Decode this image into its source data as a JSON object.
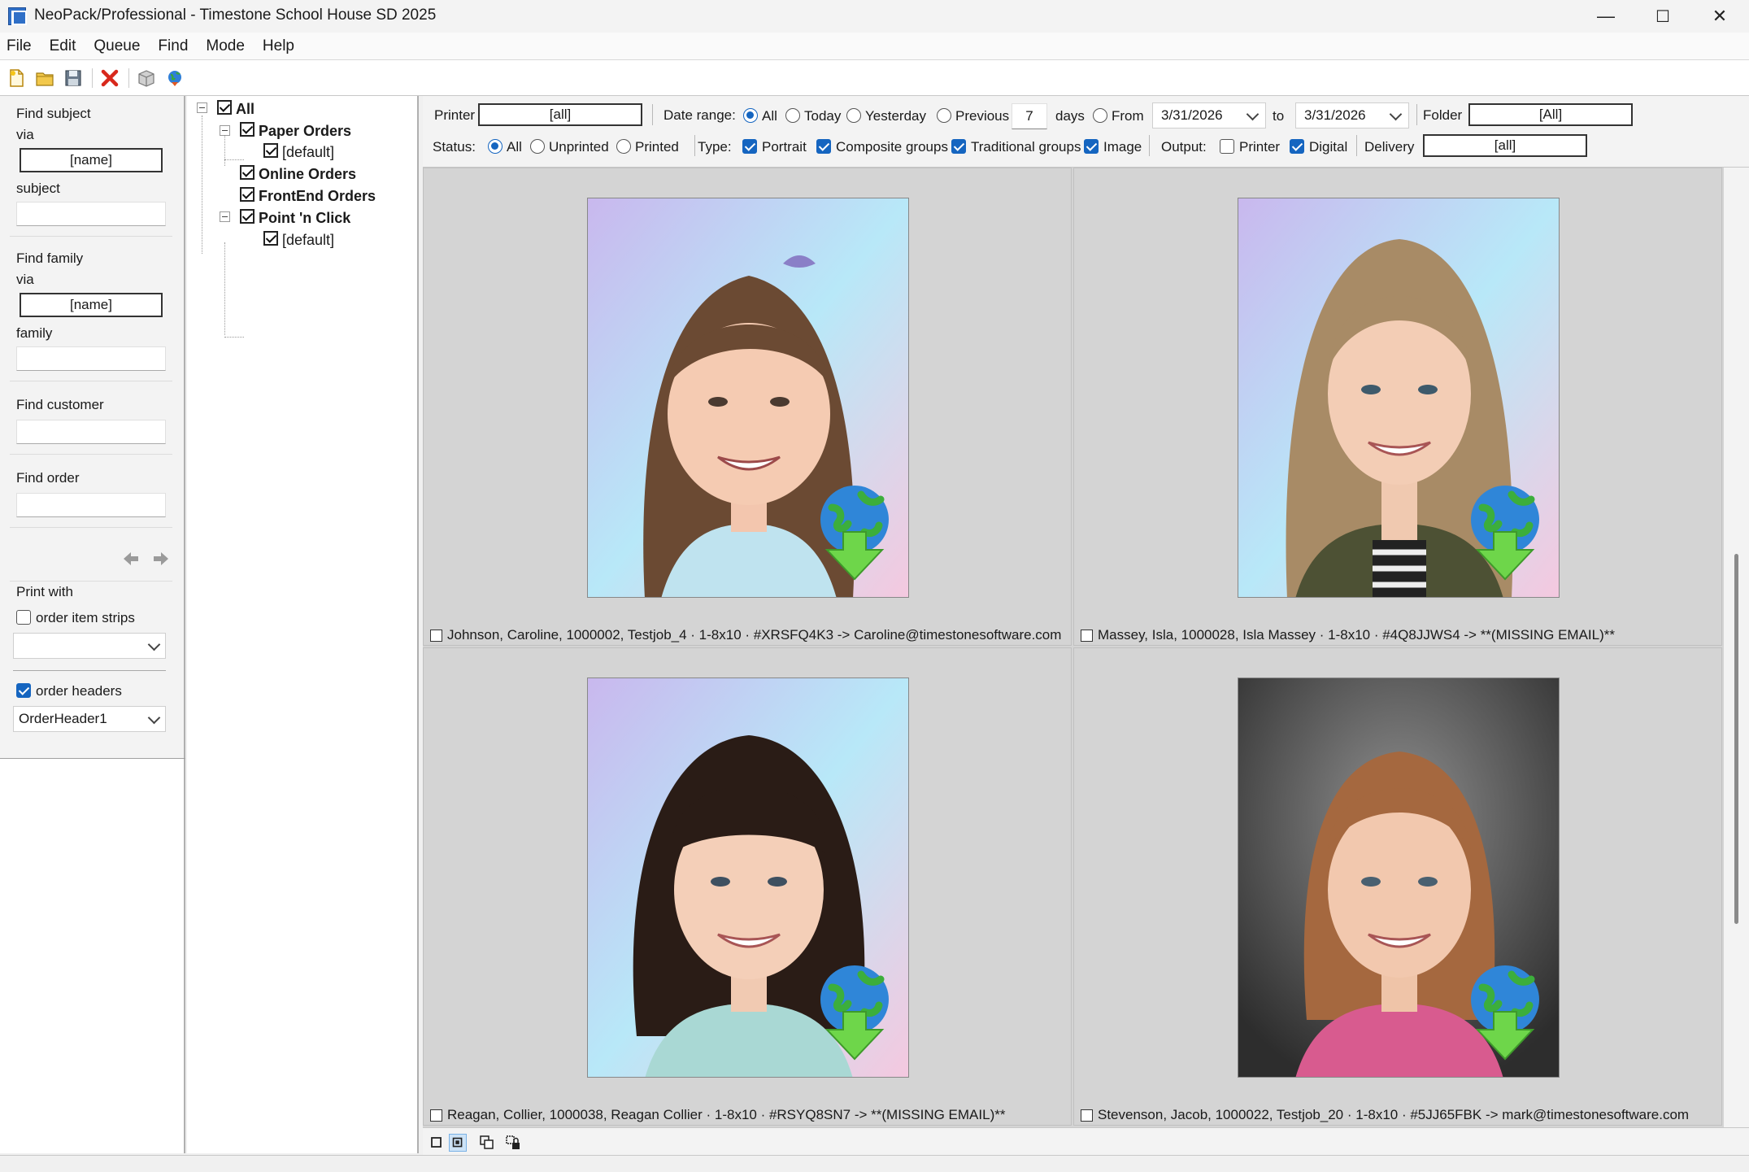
{
  "window": {
    "title": "NeoPack/Professional - Timestone School House SD 2025",
    "minimize": "—",
    "maximize": "☐",
    "close": "✕"
  },
  "menu": [
    "File",
    "Edit",
    "Queue",
    "Find",
    "Mode",
    "Help"
  ],
  "toolbar": {
    "icons": [
      "new-icon",
      "open-folder-icon",
      "save-icon",
      "delete-icon",
      "package-icon",
      "globe-upload-icon"
    ]
  },
  "left_panel": {
    "find_subject_label": "Find subject",
    "via1_label": "via",
    "via1_value": "[name]",
    "subject_label": "subject",
    "subject_value": "",
    "find_family_label": "Find family",
    "via2_label": "via",
    "via2_value": "[name]",
    "family_label": "family",
    "family_value": "",
    "find_customer_label": "Find customer",
    "find_customer_value": "",
    "find_order_label": "Find order",
    "find_order_value": "",
    "print_with_label": "Print with",
    "order_item_strips_label": "order item strips",
    "order_item_strips_checked": false,
    "strips_select_value": "",
    "order_headers_label": "order headers",
    "order_headers_checked": true,
    "headers_select_value": "OrderHeader1"
  },
  "tree": {
    "items": [
      {
        "label": "All",
        "bold": true,
        "checked": true
      },
      {
        "label": "Paper Orders",
        "bold": true,
        "checked": true
      },
      {
        "label": "[default]",
        "bold": false,
        "checked": true
      },
      {
        "label": "Online Orders",
        "bold": true,
        "checked": true
      },
      {
        "label": "FrontEnd Orders",
        "bold": true,
        "checked": true
      },
      {
        "label": "Point 'n Click",
        "bold": true,
        "checked": true
      },
      {
        "label": "[default]",
        "bold": false,
        "checked": true
      }
    ]
  },
  "filters": {
    "printer_label": "Printer",
    "printer_value": "[all]",
    "date_range_label": "Date range:",
    "date_all": "All",
    "date_today": "Today",
    "date_yesterday": "Yesterday",
    "date_previous": "Previous",
    "previous_days": "7",
    "days_label": "days",
    "date_from": "From",
    "from_date": "3/31/2026",
    "to_label": "to",
    "to_date": "3/31/2026",
    "folder_label": "Folder",
    "folder_value": "[All]",
    "status_label": "Status:",
    "status_all": "All",
    "status_unprinted": "Unprinted",
    "status_printed": "Printed",
    "type_label": "Type:",
    "type_portrait": "Portrait",
    "type_composite": "Composite groups",
    "type_traditional": "Traditional groups",
    "type_image": "Image",
    "output_label": "Output:",
    "output_printer": "Printer",
    "output_digital": "Digital",
    "delivery_label": "Delivery",
    "delivery_value": "[all]",
    "selected_date_range": "All",
    "selected_status": "All",
    "type_checked": {
      "portrait": true,
      "composite": true,
      "traditional": true,
      "image": true
    },
    "output_checked": {
      "printer": false,
      "digital": true
    }
  },
  "orders": [
    {
      "caption": "Johnson, Caroline, 1000002, Testjob_4 · 1-8x10 · #XRSFQ4K3 -> Caroline@timestonesoftware.com",
      "background": "pastel",
      "hair": "#6b4a33"
    },
    {
      "caption": "Massey, Isla, 1000028, Isla Massey · 1-8x10 · #4Q8JJWS4 ->  **(MISSING EMAIL)**",
      "background": "pastel",
      "hair": "#a88b66"
    },
    {
      "caption": "Reagan, Collier, 1000038, Reagan Collier · 1-8x10 · #RSYQ8SN7 ->  **(MISSING EMAIL)**",
      "background": "pastel",
      "hair": "#2a1c16"
    },
    {
      "caption": "Stevenson, Jacob, 1000022, Testjob_20 · 1-8x10 · #5JJ65FBK -> mark@timestonesoftware.com",
      "background": "grey",
      "hair": "#a5683f"
    }
  ],
  "view_modes": [
    "single-view-icon",
    "grid-view-icon",
    "multi-view-icon",
    "locked-view-icon"
  ]
}
